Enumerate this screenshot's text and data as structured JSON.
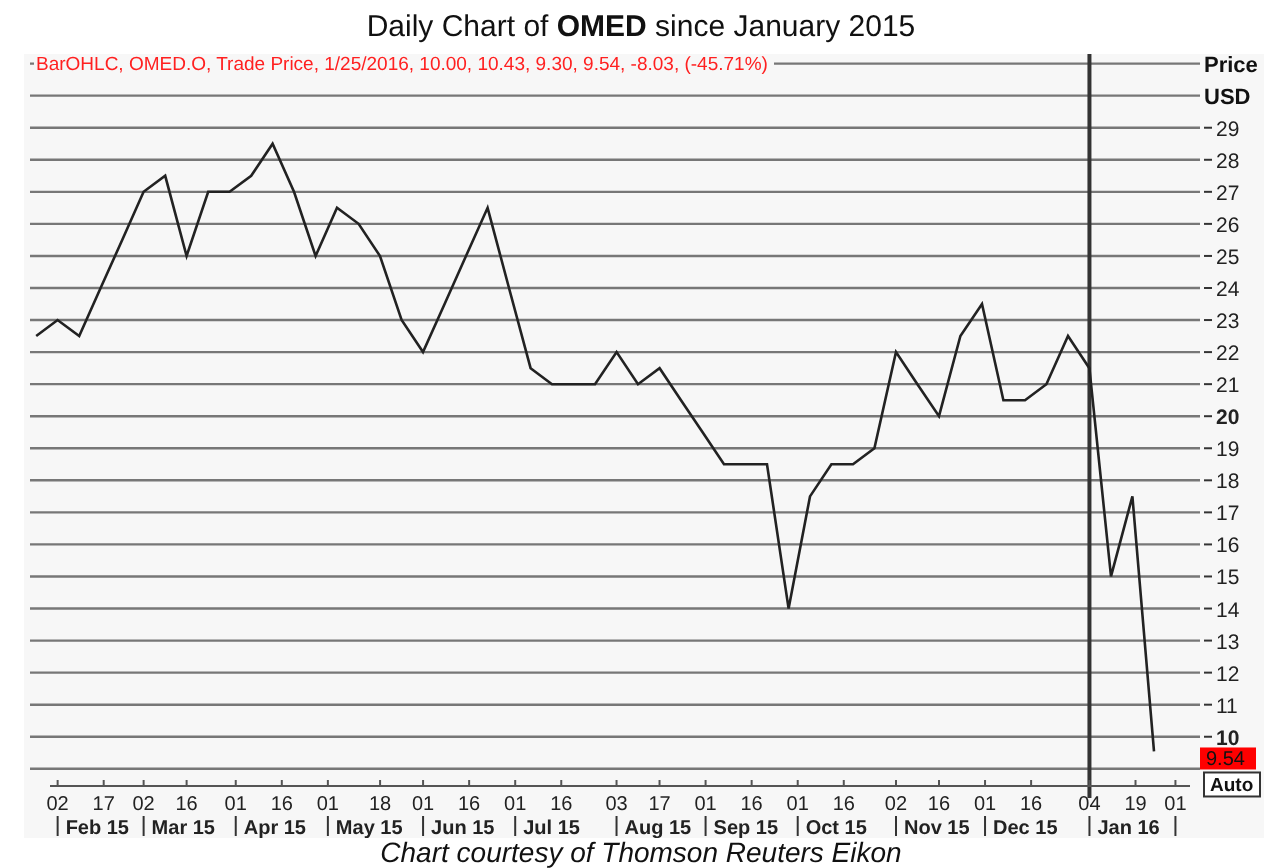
{
  "title": "Daily Chart of **OMED** since January 2015",
  "chart": {
    "legend": "BarOHLC, OMED.O, Trade Price, 1/25/2016, 10.00, 10.43, 9.30, 9.54, -8.03, (-45.71%)",
    "axis_title": "Price",
    "axis_unit": "USD",
    "last_price": "9.54",
    "auto_button": "Auto",
    "month_labels": [
      "Feb 15",
      "Mar 15",
      "Apr 15",
      "May 15",
      "Jun 15",
      "Jul 15",
      "Aug 15",
      "Sep 15",
      "Oct 15",
      "Nov 15",
      "Dec 15",
      "Jan 16"
    ],
    "chart_data": {
      "type": "line",
      "xlim": [
        "2015-01-24",
        "2016-02-09"
      ],
      "ylim": [
        8.9,
        31.3
      ],
      "x": [
        "2015-01-26",
        "2015-02-02",
        "2015-02-09",
        "2015-02-16",
        "2015-02-23",
        "2015-03-02",
        "2015-03-09",
        "2015-03-16",
        "2015-03-23",
        "2015-03-30",
        "2015-04-06",
        "2015-04-13",
        "2015-04-20",
        "2015-04-27",
        "2015-05-04",
        "2015-05-11",
        "2015-05-18",
        "2015-05-25",
        "2015-06-01",
        "2015-06-08",
        "2015-06-15",
        "2015-06-22",
        "2015-06-29",
        "2015-07-06",
        "2015-07-13",
        "2015-07-20",
        "2015-07-27",
        "2015-08-03",
        "2015-08-10",
        "2015-08-17",
        "2015-08-24",
        "2015-08-31",
        "2015-09-07",
        "2015-09-14",
        "2015-09-21",
        "2015-09-28",
        "2015-10-05",
        "2015-10-12",
        "2015-10-19",
        "2015-10-26",
        "2015-11-02",
        "2015-11-09",
        "2015-11-16",
        "2015-11-23",
        "2015-11-30",
        "2015-12-07",
        "2015-12-14",
        "2015-12-21",
        "2015-12-28",
        "2016-01-04",
        "2016-01-11",
        "2016-01-18",
        "2016-01-25"
      ],
      "series": [
        {
          "color": "#222222",
          "values": [
            22.5,
            23,
            22.5,
            24,
            25.5,
            27,
            27.5,
            25,
            27,
            27,
            27.5,
            28.5,
            27,
            25,
            26.5,
            26,
            25,
            23,
            22,
            23.5,
            25,
            26.5,
            24,
            21.5,
            21,
            21,
            21,
            22,
            21,
            21.5,
            20.5,
            19.5,
            18.5,
            18.5,
            18.5,
            14,
            17.5,
            18.5,
            18.5,
            19,
            22,
            21,
            20,
            22.5,
            23.5,
            20.5,
            20.5,
            21,
            22.5,
            21.5,
            15,
            17.5,
            9.54
          ]
        }
      ],
      "yticks": [
        10,
        11,
        12,
        13,
        14,
        15,
        16,
        17,
        18,
        19,
        20,
        21,
        22,
        23,
        24,
        25,
        26,
        27,
        28,
        29
      ],
      "xticks": [
        {
          "value": "2015-02-02",
          "label": "02"
        },
        {
          "value": "2015-02-17",
          "label": "17"
        },
        {
          "value": "2015-03-02",
          "label": "02"
        },
        {
          "value": "2015-03-16",
          "label": "16"
        },
        {
          "value": "2015-04-01",
          "label": "01"
        },
        {
          "value": "2015-04-16",
          "label": "16"
        },
        {
          "value": "2015-05-01",
          "label": "01"
        },
        {
          "value": "2015-05-18",
          "label": "18"
        },
        {
          "value": "2015-06-01",
          "label": "01"
        },
        {
          "value": "2015-06-16",
          "label": "16"
        },
        {
          "value": "2015-07-01",
          "label": "01"
        },
        {
          "value": "2015-07-16",
          "label": "16"
        },
        {
          "value": "2015-08-03",
          "label": "03"
        },
        {
          "value": "2015-08-17",
          "label": "17"
        },
        {
          "value": "2015-09-01",
          "label": "01"
        },
        {
          "value": "2015-09-16",
          "label": "16"
        },
        {
          "value": "2015-10-01",
          "label": "01"
        },
        {
          "value": "2015-10-16",
          "label": "16"
        },
        {
          "value": "2015-11-02",
          "label": "02"
        },
        {
          "value": "2015-11-16",
          "label": "16"
        },
        {
          "value": "2015-12-01",
          "label": "01"
        },
        {
          "value": "2015-12-16",
          "label": "16"
        },
        {
          "value": "2016-01-04",
          "label": "04"
        },
        {
          "value": "2016-01-19",
          "label": "19"
        },
        {
          "value": "2016-02-01",
          "label": "01"
        }
      ],
      "grid": true,
      "ref_lines": [
        {
          "axis": "x",
          "value": "2016-01-04"
        }
      ]
    }
  },
  "caption": "Chart courtesy of Thomson Reuters Eikon"
}
